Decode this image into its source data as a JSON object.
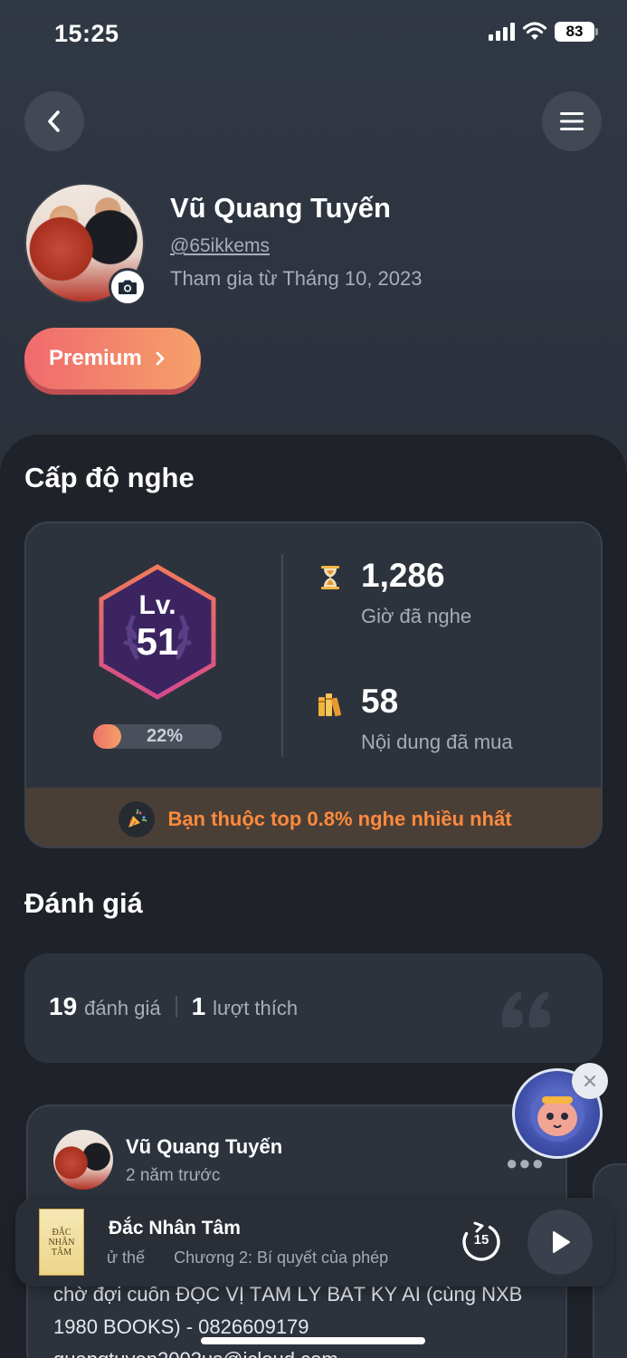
{
  "status_bar": {
    "time": "15:25",
    "battery": "83"
  },
  "profile": {
    "name": "Vũ Quang Tuyến",
    "handle": "@65ikkems",
    "joined": "Tham gia từ Tháng 10, 2023",
    "premium_label": "Premium"
  },
  "listening": {
    "section_title": "Cấp độ nghe",
    "level_prefix": "Lv.",
    "level": "51",
    "progress_label": "22%",
    "progress_fraction": 0.22,
    "hours_value": "1,286",
    "hours_label": "Giờ đã nghe",
    "purchased_value": "58",
    "purchased_label": "Nội dung đã mua",
    "top_text": "Bạn thuộc top 0.8% nghe nhiều nhất"
  },
  "reviews": {
    "section_title": "Đánh giá",
    "count": "19",
    "count_label": "đánh giá",
    "likes": "1",
    "likes_label": "lượt thích",
    "items": [
      {
        "author": "Vũ Quang Tuyến",
        "time": "2 năm trước",
        "text_lines": [
          "chờ đợi cuốn ĐỌC VỊ TÂM LÝ BẤT KỲ AI (cùng NXB",
          "1980 BOOKS) - 0826609179",
          "quangtuyen2002us@icloud.com"
        ]
      }
    ]
  },
  "player": {
    "title": "Đắc Nhân Tâm",
    "subtitle_left": "ử thế",
    "subtitle_right": "Chương 2: Bí quyết của phép",
    "replay_seconds": "15",
    "cover_lines": [
      "ĐẮC",
      "NHÂN",
      "TÂM"
    ]
  },
  "colors": {
    "background": "#2b313b",
    "sheet": "#1f2228",
    "card": "#2d333d",
    "premium_start": "#f06a6e",
    "premium_end": "#f5a169",
    "accent_orange": "#ff8a3d",
    "hex_border": "#e0567a",
    "hex_fill": "#3b2460"
  },
  "icons": {
    "back": "chevron-left-icon",
    "menu": "hamburger-menu-icon",
    "camera": "camera-icon",
    "hourglass": "hourglass-icon",
    "books": "books-icon",
    "party": "party-popper-icon",
    "quote": "quote-icon",
    "more": "more-dots-icon",
    "replay": "replay-15-icon",
    "play": "play-icon",
    "close": "close-icon"
  }
}
